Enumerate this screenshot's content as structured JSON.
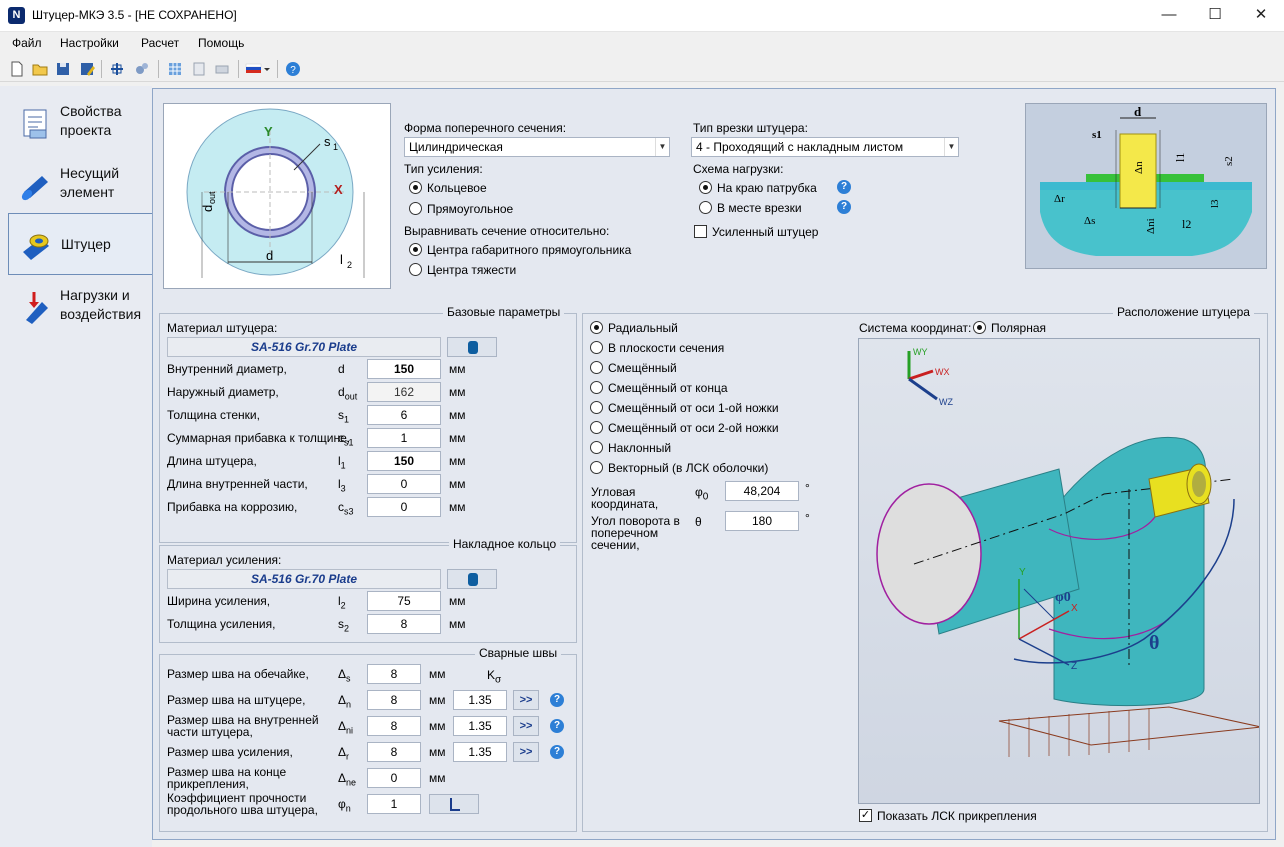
{
  "window": {
    "title": "Штуцер-МКЭ 3.5 - [НЕ СОХРАНЕНО]",
    "icon_letter": "N"
  },
  "menu": [
    "Файл",
    "Настройки",
    "Расчет",
    "Помощь"
  ],
  "nav": [
    {
      "label1": "Свойства",
      "label2": "проекта"
    },
    {
      "label1": "Несущий",
      "label2": "элемент"
    },
    {
      "label1": "Штуцер",
      "label2": ""
    },
    {
      "label1": "Нагрузки и",
      "label2": "воздействия"
    }
  ],
  "section": {
    "shape_label": "Форма поперечного сечения:",
    "shape_value": "Цилиндрическая",
    "reinf_type_label": "Тип усиления:",
    "reinf_ring": "Кольцевое",
    "reinf_rect": "Прямоугольное",
    "align_label": "Выравнивать сечение относительно:",
    "align_bbox": "Центра габаритного прямоугольника",
    "align_cg": "Центра тяжести",
    "insert_type_label": "Тип врезки штуцера:",
    "insert_type_value": "4  - Проходящий с накладным листом",
    "load_scheme_label": "Схема нагрузки:",
    "load_edge": "На краю патрубка",
    "load_insert": "В месте врезки",
    "reinforced_nozzle": "Усиленный штуцер"
  },
  "cross_section_fig": {
    "y": "Y",
    "x": "X",
    "s1": "s",
    "s1_sub": "1",
    "dout": "d",
    "dout_sub": "out",
    "d": "d",
    "l2": "l",
    "l2_sub": "2"
  },
  "detail_fig": {
    "d": "d",
    "s1": "s1",
    "dn": "Δn",
    "l1": "l1",
    "s2": "s2",
    "dr": "Δr",
    "ds": "Δs",
    "dni": "Δni",
    "l2": "l2",
    "l3": "l3"
  },
  "base": {
    "legend": "Базовые параметры",
    "material_label": "Материал штуцера:",
    "material": "SA-516 Gr.70 Plate",
    "rows": [
      {
        "label": "Внутренний диаметр,",
        "sym": "d",
        "sub": "",
        "value": "150",
        "unit": "мм"
      },
      {
        "label": "Наружный диаметр,",
        "sym": "d",
        "sub": "out",
        "value": "162",
        "unit": "мм"
      },
      {
        "label": "Толщина стенки,",
        "sym": "s",
        "sub": "1",
        "value": "6",
        "unit": "мм"
      },
      {
        "label": "Суммарная прибавка к толщине,",
        "sym": "c",
        "sub": "s1",
        "value": "1",
        "unit": "мм"
      },
      {
        "label": "Длина штуцера,",
        "sym": "l",
        "sub": "1",
        "value": "150",
        "unit": "мм"
      },
      {
        "label": "Длина внутренней части,",
        "sym": "l",
        "sub": "3",
        "value": "0",
        "unit": "мм"
      },
      {
        "label": "Прибавка на коррозию,",
        "sym": "c",
        "sub": "s3",
        "value": "0",
        "unit": "мм"
      }
    ]
  },
  "ring": {
    "legend": "Накладное кольцо",
    "material_label": "Материал усиления:",
    "material": "SA-516 Gr.70 Plate",
    "rows": [
      {
        "label": "Ширина усиления,",
        "sym": "l",
        "sub": "2",
        "value": "75",
        "unit": "мм"
      },
      {
        "label": "Толщина усиления,",
        "sym": "s",
        "sub": "2",
        "value": "8",
        "unit": "мм"
      }
    ]
  },
  "welds": {
    "legend": "Сварные швы",
    "k_header": "K",
    "k_sub": "σ",
    "rows": [
      {
        "label": "Размер шва на обечайке,",
        "sym": "Δ",
        "sub": "s",
        "value": "8",
        "unit": "мм",
        "k": ""
      },
      {
        "label": "Размер шва на штуцере,",
        "sym": "Δ",
        "sub": "n",
        "value": "8",
        "unit": "мм",
        "k": "1.35"
      },
      {
        "label": "Размер шва на внутренней части штуцера,",
        "sym": "Δ",
        "sub": "ni",
        "value": "8",
        "unit": "мм",
        "k": "1.35"
      },
      {
        "label": "Размер шва усиления,",
        "sym": "Δ",
        "sub": "r",
        "value": "8",
        "unit": "мм",
        "k": "1.35"
      },
      {
        "label": "Размер шва на конце прикрепления,",
        "sym": "Δ",
        "sub": "ne",
        "value": "0",
        "unit": "мм",
        "k": ""
      },
      {
        "label": "Коэффициент прочности продольного шва штуцера,",
        "sym": "φ",
        "sub": "n",
        "value": "1",
        "unit": "",
        "k": ""
      }
    ],
    "arrow_label": ">>"
  },
  "placement": {
    "legend": "Расположение штуцера",
    "options": [
      "Радиальный",
      "В плоскости сечения",
      "Смещённый",
      "Смещённый от конца",
      "Смещённый от оси 1-ой ножки",
      "Смещённый от оси 2-ой ножки",
      "Наклонный",
      "Векторный (в ЛСК оболочки)"
    ],
    "angle_label": "Угловая координата,",
    "angle_sym": "φ",
    "angle_sub": "0",
    "angle_value": "48,204",
    "angle_unit": "°",
    "rot_label": "Угол поворота в поперечном сечении,",
    "rot_sym": "θ",
    "rot_value": "180",
    "rot_unit": "°",
    "coord_label": "Система координат:",
    "coord_value": "Полярная",
    "show_lcs": "Показать ЛСК прикрепления"
  },
  "view3d": {
    "wy": "WY",
    "wx": "WX",
    "wz": "WZ",
    "theta": "θ",
    "phi": "φ0",
    "x": "X",
    "y": "Y",
    "z": "Z"
  },
  "colors": {
    "accent": "#1a3c8c",
    "pipe": "#41b8c4",
    "nozzle": "#e8e020"
  }
}
